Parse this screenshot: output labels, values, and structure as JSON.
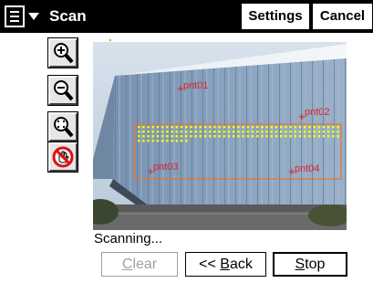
{
  "titlebar": {
    "menu_icon": "start-menu-icon",
    "title": "Scan",
    "settings_label": "Settings",
    "cancel_label": "Cancel"
  },
  "tools": [
    {
      "name": "zoom-in-icon"
    },
    {
      "name": "zoom-out-icon"
    },
    {
      "name": "zoom-extents-icon"
    },
    {
      "name": "pan-disabled-icon"
    }
  ],
  "photo": {
    "points": [
      {
        "label": "pnt01"
      },
      {
        "label": "pnt02"
      },
      {
        "label": "pnt03"
      },
      {
        "label": "pnt04"
      }
    ],
    "scan_area_color": "#e8732a",
    "scan_dot_color": "#ffff00",
    "point_marker_color": "#e0202a"
  },
  "status": {
    "text": "Scanning..."
  },
  "footer": {
    "clear_label": "Clear",
    "back_label": "<< Back",
    "stop_label": "Stop"
  }
}
